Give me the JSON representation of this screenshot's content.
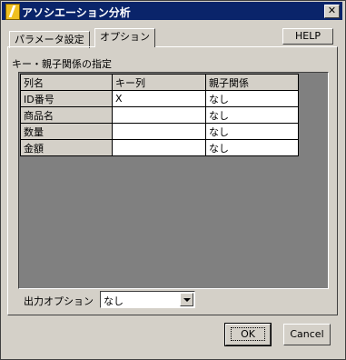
{
  "window": {
    "title": "アソシエーション分析",
    "close_label": "✕"
  },
  "tabs": [
    {
      "label": "パラメータ設定",
      "active": false
    },
    {
      "label": "オプション",
      "active": true
    }
  ],
  "help_label": "HELP",
  "group_label": "キー・親子関係の指定",
  "table": {
    "headers": [
      "列名",
      "キー列",
      "親子関係"
    ],
    "rows": [
      {
        "name": "ID番号",
        "key": "X",
        "relation": "なし"
      },
      {
        "name": "商品名",
        "key": "",
        "relation": "なし"
      },
      {
        "name": "数量",
        "key": "",
        "relation": "なし"
      },
      {
        "name": "金額",
        "key": "",
        "relation": "なし"
      }
    ]
  },
  "output_option": {
    "label": "出力オプション",
    "value": "なし"
  },
  "buttons": {
    "ok": "OK",
    "cancel": "Cancel"
  }
}
